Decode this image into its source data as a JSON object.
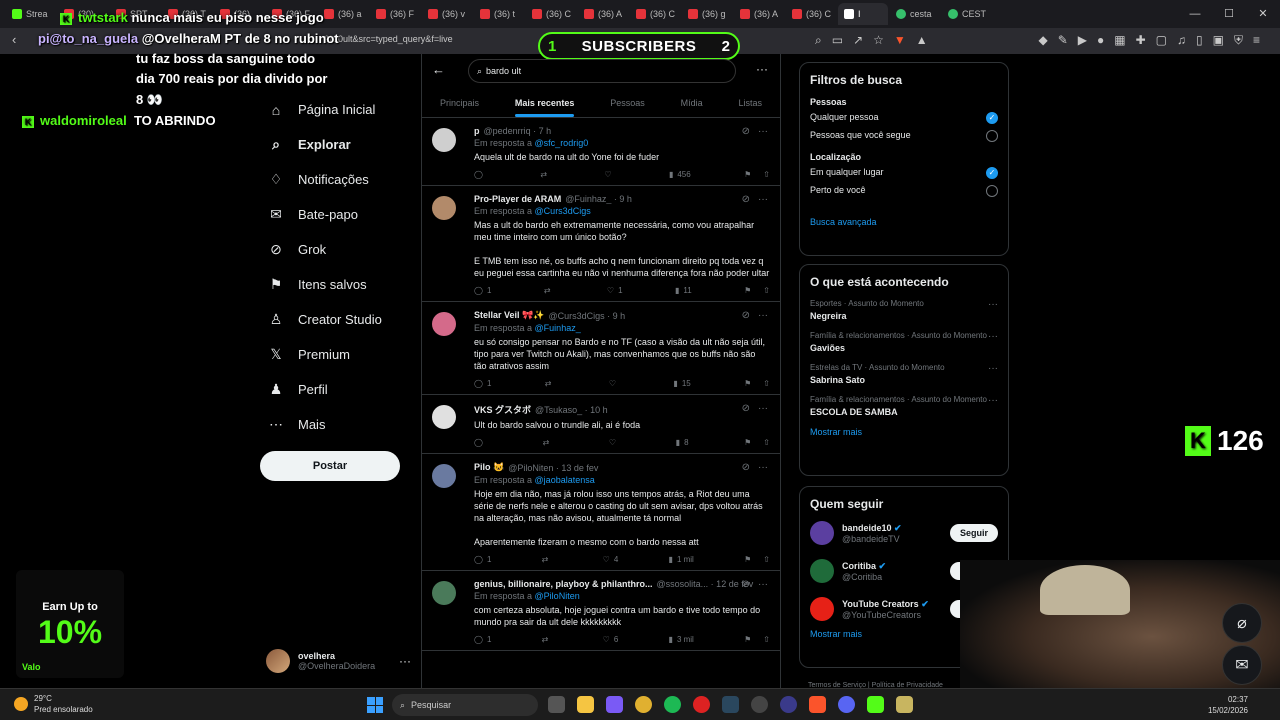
{
  "browser": {
    "tabs": [
      {
        "label": "Strea",
        "icon": "kick-icon"
      },
      {
        "label": "(30)",
        "icon": "youtube-icon"
      },
      {
        "label": "SPT",
        "icon": "youtube-icon"
      },
      {
        "label": "(36) T",
        "icon": "youtube-icon"
      },
      {
        "label": "(36)",
        "icon": "youtube-icon"
      },
      {
        "label": "(36) F",
        "icon": "youtube-icon"
      },
      {
        "label": "(36) a",
        "icon": "youtube-icon"
      },
      {
        "label": "(36) F",
        "icon": "youtube-icon"
      },
      {
        "label": "(36) v",
        "icon": "youtube-icon"
      },
      {
        "label": "(36) t",
        "icon": "youtube-icon"
      },
      {
        "label": "(36) C",
        "icon": "youtube-icon"
      },
      {
        "label": "(36) A",
        "icon": "youtube-icon"
      },
      {
        "label": "(36) C",
        "icon": "youtube-icon"
      },
      {
        "label": "(36) g",
        "icon": "youtube-icon"
      },
      {
        "label": "(36) A",
        "icon": "youtube-icon"
      },
      {
        "label": "(36) C",
        "icon": "youtube-icon"
      },
      {
        "label": "I",
        "icon": "x-icon",
        "active": true
      },
      {
        "label": "cesta",
        "icon": "green-icon"
      },
      {
        "label": "CEST",
        "icon": "green-icon"
      }
    ],
    "url": "%20ult&src=typed_query&f=live"
  },
  "overlay": {
    "subscribers": {
      "left": "1",
      "label": "SUBSCRIBERS",
      "right": "2"
    },
    "chat": [
      {
        "user": "twtstark",
        "message": "nunca mais eu piso nesse jogo"
      },
      {
        "user": "pi@to_na_guela",
        "message": "@OvelheraM PT de 8 no rubinot"
      },
      {
        "user": "",
        "message": "tu faz boss da sanguine todo"
      },
      {
        "user": "",
        "message": "dia 700 reais por dia divido por"
      },
      {
        "user": "",
        "message": "8 👀"
      },
      {
        "user": "waldomiroleal",
        "message": "TO ABRINDO"
      }
    ],
    "kick_count": "126",
    "promo": {
      "top": "Earn Up to",
      "big": "10%",
      "brand": "Valo"
    }
  },
  "nav": {
    "items": [
      {
        "label": "Página Inicial",
        "icon": "home-icon"
      },
      {
        "label": "Explorar",
        "icon": "search-icon",
        "bold": true
      },
      {
        "label": "Notificações",
        "icon": "bell-icon"
      },
      {
        "label": "Bate-papo",
        "icon": "mail-icon"
      },
      {
        "label": "Grok",
        "icon": "grok-icon"
      },
      {
        "label": "Itens salvos",
        "icon": "bookmark-icon"
      },
      {
        "label": "Creator Studio",
        "icon": "creator-icon"
      },
      {
        "label": "Premium",
        "icon": "x-logo-icon"
      },
      {
        "label": "Perfil",
        "icon": "person-icon"
      },
      {
        "label": "Mais",
        "icon": "more-circle-icon"
      }
    ],
    "post_label": "Postar",
    "account": {
      "name": "ovelhera",
      "handle": "@OvelheraDoidera"
    }
  },
  "search": {
    "value": "bardo ult"
  },
  "tabs": [
    "Principais",
    "Mais recentes",
    "Pessoas",
    "Mídia",
    "Listas"
  ],
  "tweets": [
    {
      "name": "p",
      "handle": "@pedenrriq · 7 h",
      "reply_prefix": "Em resposta a",
      "reply_to": "@sfc_rodrig0",
      "text": "Aquela ult de bardo na ult do Yone foi de fuder",
      "replies": "",
      "retweets": "",
      "likes": "",
      "views": "456",
      "avatar_color": "#cfcfcf"
    },
    {
      "name": "Pro-Player de ARAM",
      "handle": "@Fuinhaz_ · 9 h",
      "reply_prefix": "Em resposta a",
      "reply_to": "@Curs3dCigs",
      "text": "Mas a ult do bardo eh extremamente necessária, como vou atrapalhar meu time inteiro com um único botão?\n\nE TMB tem isso né, os buffs acho q nem funcionam direito pq toda vez q eu peguei essa cartinha eu não vi nenhuma diferença fora não poder ultar",
      "replies": "1",
      "retweets": "",
      "likes": "1",
      "views": "11",
      "avatar_color": "#b28a6a"
    },
    {
      "name": "Stellar Veil 🎀✨",
      "handle": "@Curs3dCigs · 9 h",
      "reply_prefix": "Em resposta a",
      "reply_to": "@Fuinhaz_",
      "text": "eu só consigo pensar no Bardo e no TF (caso a visão da ult não seja útil, tipo para ver Twitch ou Akali), mas convenhamos que os buffs não são tão atrativos assim",
      "replies": "1",
      "retweets": "",
      "likes": "",
      "views": "15",
      "avatar_color": "#d46a8a"
    },
    {
      "name": "VKS グスタボ",
      "handle": "@Tsukaso_ · 10 h",
      "reply_prefix": "",
      "reply_to": "",
      "text": "Ult do bardo salvou o trundle ali, ai é foda",
      "replies": "",
      "retweets": "",
      "likes": "",
      "views": "8",
      "avatar_color": "#e0e0e0"
    },
    {
      "name": "Pilo 😺",
      "handle": "@PiloNiten · 13 de fev",
      "reply_prefix": "Em resposta a",
      "reply_to": "@jaobalatensa",
      "text": "Hoje em dia não, mas já rolou isso uns tempos atrás, a Riot deu uma série de nerfs nele e alterou o casting do ult sem avisar, dps voltou atrás na alteração, mas não avisou, atualmente tá normal\n\nAparentemente fizeram o mesmo com o bardo nessa att",
      "replies": "1",
      "retweets": "",
      "likes": "4",
      "views": "1 mil",
      "avatar_color": "#6a7aa0"
    },
    {
      "name": "genius, billionaire, playboy & philanthro...",
      "handle": "@ssosolita... · 12 de fev",
      "reply_prefix": "Em resposta a",
      "reply_to": "@PiloNiten",
      "text": "com certeza absoluta, hoje joguei contra um bardo e tive todo tempo do mundo pra sair da ult dele kkkkkkkkk",
      "replies": "1",
      "retweets": "",
      "likes": "6",
      "views": "3 mil",
      "avatar_color": "#4a7a5a"
    }
  ],
  "filters": {
    "title": "Filtros de busca",
    "people_title": "Pessoas",
    "people": [
      {
        "label": "Qualquer pessoa",
        "on": true
      },
      {
        "label": "Pessoas que você segue",
        "on": false
      }
    ],
    "location_title": "Localização",
    "location": [
      {
        "label": "Em qualquer lugar",
        "on": true
      },
      {
        "label": "Perto de você",
        "on": false
      }
    ],
    "advanced": "Busca avançada"
  },
  "trends": {
    "title": "O que está acontecendo",
    "items": [
      {
        "category": "Esportes · Assunto do Momento",
        "name": "Negreira"
      },
      {
        "category": "Família & relacionamentos · Assunto do Momento",
        "name": "Gaviões"
      },
      {
        "category": "Estrelas da TV · Assunto do Momento",
        "name": "Sabrina Sato"
      },
      {
        "category": "Família & relacionamentos · Assunto do Momento",
        "name": "ESCOLA DE SAMBA"
      }
    ],
    "more": "Mostrar mais"
  },
  "who_to_follow": {
    "title": "Quem seguir",
    "items": [
      {
        "name": "bandeide10",
        "handle": "@bandeideTV",
        "button": "Seguir",
        "avatar_color": "#5b3fa0"
      },
      {
        "name": "Coritiba",
        "handle": "@Coritiba",
        "button": "Seguir",
        "avatar_color": "#1f6b3a"
      },
      {
        "name": "YouTube Creators",
        "handle": "@YouTubeCreators",
        "button": "Seguir",
        "avatar_color": "#e62117"
      }
    ],
    "more": "Mostrar mais"
  },
  "footer": "Termos de Serviço  |  Política de Privacidade",
  "taskbar": {
    "temp": "29°C",
    "weather": "Pred ensolarado",
    "search_placeholder": "Pesquisar",
    "time": "02:37",
    "date": "15/02/2026"
  }
}
